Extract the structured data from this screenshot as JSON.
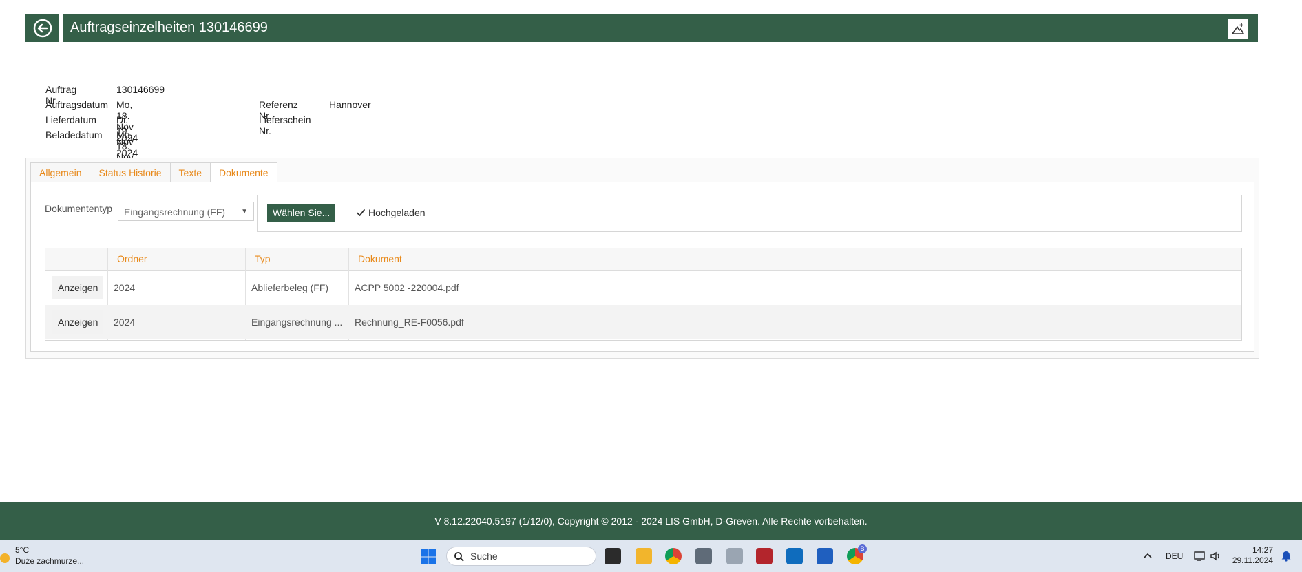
{
  "header": {
    "title": "Auftragseinzelheiten 130146699"
  },
  "info": {
    "left": [
      {
        "label": "Auftrag Nr.",
        "value": "130146699"
      },
      {
        "label": "Auftragsdatum",
        "value": "Mo, 18. Nov 2024"
      },
      {
        "label": "Lieferdatum",
        "value": "Di, 19. Nov 2024"
      },
      {
        "label": "Beladedatum",
        "value": "Mo, 18. Nov 2024"
      }
    ],
    "right": [
      {
        "label": "Referenz Nr.",
        "value": "Hannover"
      },
      {
        "label": "Lieferschein Nr.",
        "value": ""
      }
    ]
  },
  "tabs": [
    {
      "label": "Allgemein"
    },
    {
      "label": "Status Historie"
    },
    {
      "label": "Texte"
    },
    {
      "label": "Dokumente",
      "active": true
    }
  ],
  "documents": {
    "type_label": "Dokumententyp",
    "type_value": "Eingangsrechnung (FF)",
    "choose_label": "Wählen Sie...",
    "uploaded_label": "Hochgeladen",
    "columns": [
      "Ordner",
      "Typ",
      "Dokument"
    ],
    "rows": [
      {
        "action": "Anzeigen",
        "ordner": "2024",
        "typ": "Ablieferbeleg (FF)",
        "dokument": "ACPP 5002 -220004.pdf"
      },
      {
        "action": "Anzeigen",
        "ordner": "2024",
        "typ": "Eingangsrechnung ...",
        "dokument": "Rechnung_RE-F0056.pdf"
      }
    ]
  },
  "footer": {
    "text": "V 8.12.22040.5197 (1/12/0), Copyright © 2012 - 2024 LIS GmbH, D-Greven. Alle Rechte vorbehalten."
  },
  "taskbar": {
    "weather_temp": "5°C",
    "weather_desc": "Duże zachmurze...",
    "search_placeholder": "Suche",
    "language": "DEU",
    "time": "14:27",
    "date": "29.11.2024",
    "chrome_badge": "B"
  },
  "colors": {
    "brand_green": "#345f48",
    "accent_orange": "#e8891a"
  }
}
